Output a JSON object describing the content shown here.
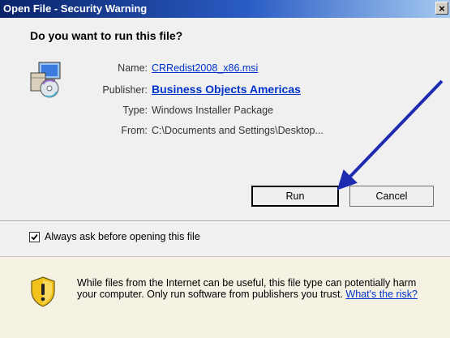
{
  "dialog": {
    "title": "Open File - Security Warning",
    "close_glyph": "×",
    "question": "Do you want to run this file?"
  },
  "file": {
    "icon": "installer-package-icon",
    "name_label": "Name:",
    "name_value": "CRRedist2008_x86.msi",
    "publisher_label": "Publisher:",
    "publisher_value": "Business Objects Americas",
    "type_label": "Type:",
    "type_value": "Windows Installer Package",
    "from_label": "From:",
    "from_value": "C:\\Documents and Settings\\Desktop..."
  },
  "buttons": {
    "run_label": "Run",
    "cancel_label": "Cancel"
  },
  "checkbox": {
    "label": "Always ask before opening this file",
    "checked": true
  },
  "warning": {
    "icon": "shield-warning-icon",
    "text": "While files from the Internet can be useful, this file type can potentially harm your computer. Only run software from publishers you trust.",
    "link_text": "What's the risk?"
  },
  "annotation": {
    "icon": "arrow-icon",
    "color": "#1e2bb0"
  },
  "colors": {
    "title_bar": "#0a246a",
    "link": "#0033cc"
  }
}
